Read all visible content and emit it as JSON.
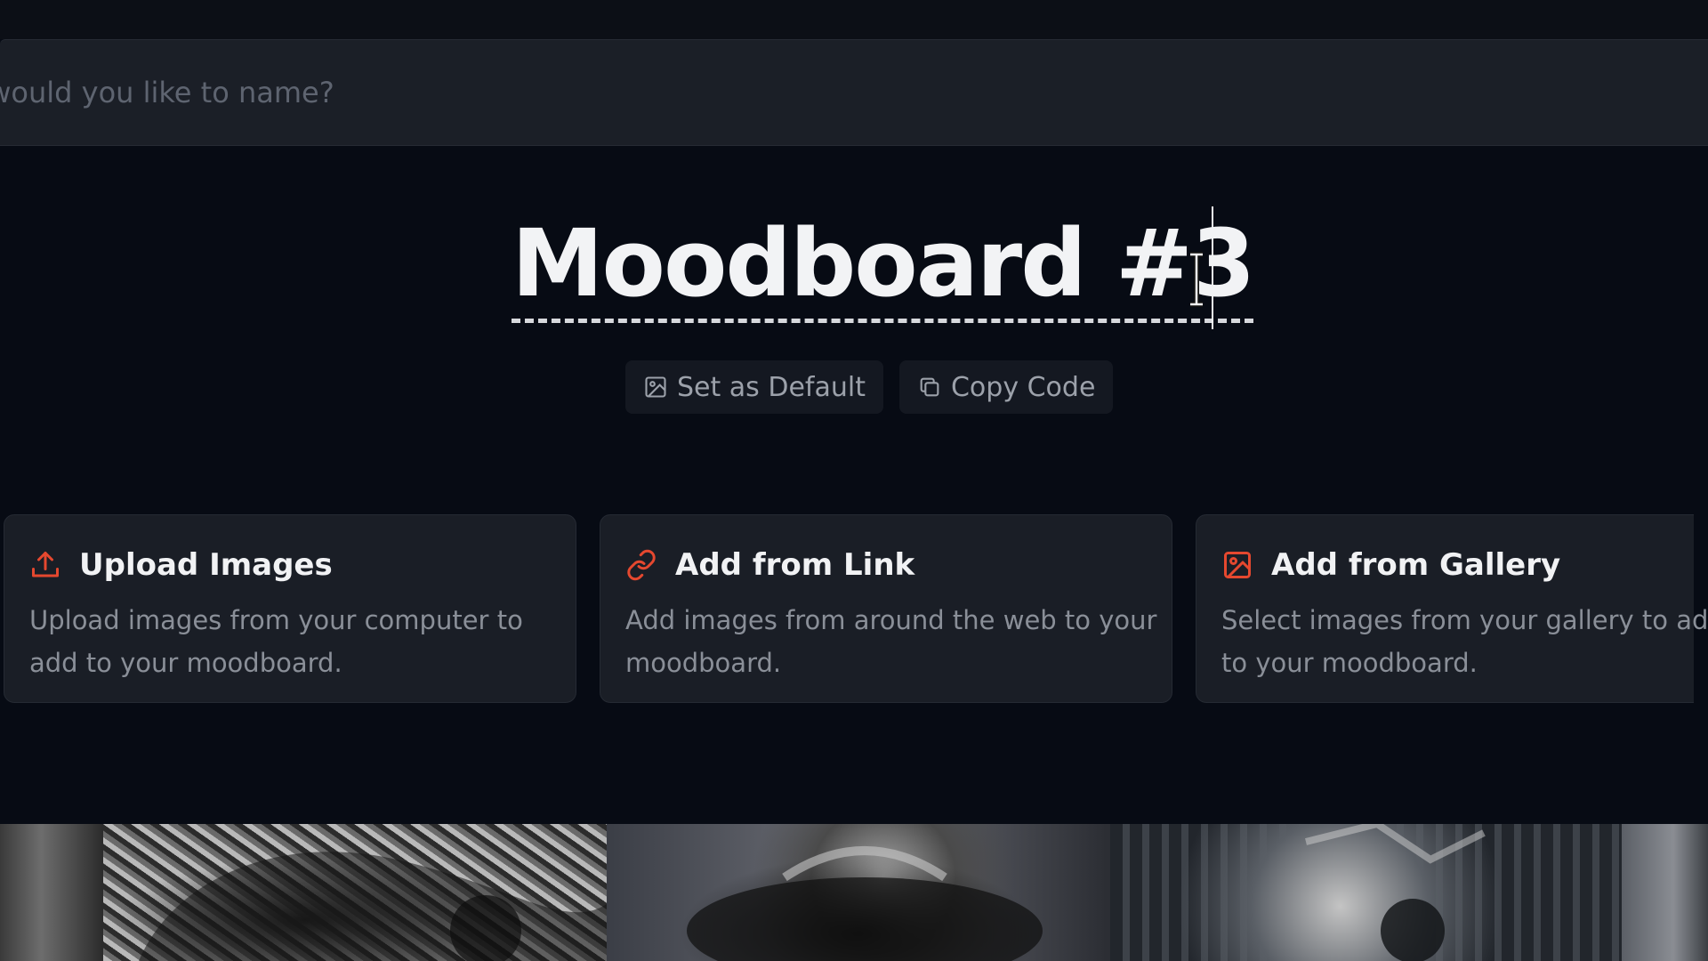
{
  "search": {
    "placeholder": "What would you like to name?"
  },
  "board": {
    "title": "Moodboard #3"
  },
  "actions": {
    "set_default_label": "Set as Default",
    "copy_code_label": "Copy Code"
  },
  "cards": [
    {
      "title": "Upload Images",
      "description": "Upload images from your computer to add to your moodboard.",
      "icon": "upload-icon"
    },
    {
      "title": "Add from Link",
      "description": "Add images from around the web to your moodboard.",
      "icon": "link-icon"
    },
    {
      "title": "Add from Gallery",
      "description_line1": "Select images from your gallery to add",
      "description_line2": "to your moodboard.",
      "icon": "gallery-icon"
    }
  ],
  "colors": {
    "accent": "#e5482f",
    "background": "#070b14",
    "card": "#1a1e26"
  }
}
